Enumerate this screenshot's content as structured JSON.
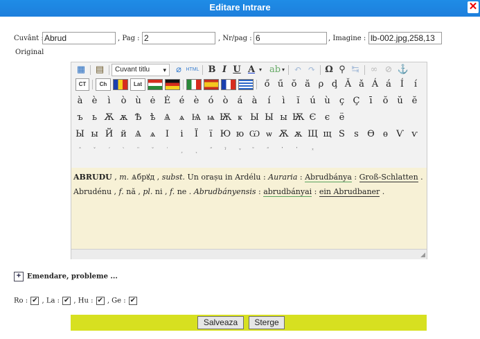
{
  "window": {
    "title": "Editare Intrare",
    "close_glyph": "✕"
  },
  "fields": {
    "cuvant_label": "Cuvânt :",
    "cuvant_value": "Abrud",
    "pag_label": ", Pag :",
    "pag_value": "2",
    "nrpag_label": ", Nr/pag :",
    "nrpag_value": "6",
    "imagine_label": ", Imagine :",
    "imagine_value": "lb-002.jpg,258,13"
  },
  "original_label": "Original",
  "toolbar": {
    "style_combo": "Cuvant titlu",
    "buttons_row1": [
      "B",
      "I",
      "U",
      "A",
      "Ω"
    ],
    "buttons_row2_boxes": [
      "CT",
      "Ch",
      "Lat"
    ],
    "accent_chars_row2": [
      "ő",
      "ű",
      "ŏ",
      "ă",
      "ρ",
      "ḑ",
      "Ǎ",
      "ǎ",
      "Á",
      "á",
      "Í",
      "í"
    ],
    "chars_row3": [
      "à",
      "è",
      "ì",
      "ò",
      "ù",
      "ė",
      "Ė",
      "é",
      "è",
      "ó",
      "ò",
      "á",
      "à",
      "í",
      "ì",
      "ĭ",
      "ú",
      "ù",
      "ç",
      "Ç",
      "ī",
      "ŏ",
      "ŭ",
      "ĕ"
    ],
    "cyr_row4": [
      "ъ",
      "ь",
      "Ѫ",
      "ѫ",
      "Ѣ",
      "ѣ",
      "Ѧ",
      "ѧ",
      "Ѩ",
      "ѩ",
      "Ѭ",
      "ҝ",
      "Ы",
      "Ы",
      "ы",
      "Ѭ",
      "Є",
      "є",
      "ё"
    ],
    "cyr_row5": [
      "Ы",
      "ы",
      "Й",
      "й",
      "Ѧ",
      "ѧ",
      "І",
      "і",
      "Ї",
      "ї",
      "Ю",
      "ю",
      "Ѡ",
      "ѡ",
      "Ѫ",
      "ѫ",
      "Щ",
      "щ",
      "Ѕ",
      "ѕ",
      "Ѳ",
      "ѳ",
      "Ѵ",
      "ѵ"
    ],
    "marks_row6": [
      "ˆ",
      "ˇ",
      "´",
      "`",
      "¨",
      "˘",
      "˙",
      "¸",
      "˛",
      "˝",
      "ˀ",
      "ͮ",
      "̃",
      "̋",
      "̓",
      "̔",
      "ͯ"
    ]
  },
  "content": {
    "headword": "ABRUDU",
    "line1_rest_a": " , ",
    "gram1": "m.",
    "cyr": "Ѧбрꙋд",
    "gram2": "subst.",
    "text1": " Un orașu in Ardélu : ",
    "latin": "Auraria",
    "sep1": " : ",
    "hungarian": "Abrudbánya",
    "sep2": " : ",
    "german": "Groß-Schlatten",
    "line2_a": "Abrudénu , ",
    "f1": "f.",
    "na": " nă , ",
    "pl": "pl.",
    "ni": " ni , ",
    "f2": "f.",
    "ne": " ne . ",
    "latin2": "Abrudbányensis",
    "sep3": " : ",
    "hungarian2": "abrudbányai",
    "sep4": " : ",
    "german2": "ein Abrudbaner"
  },
  "emendare_label": "Emendare, probleme ...",
  "langs": {
    "ro": "Ro :",
    "la": ", La :",
    "hu": ", Hu :",
    "ge": ", Ge :",
    "check": "✔"
  },
  "actions": {
    "save": "Salveaza",
    "delete": "Sterge"
  }
}
